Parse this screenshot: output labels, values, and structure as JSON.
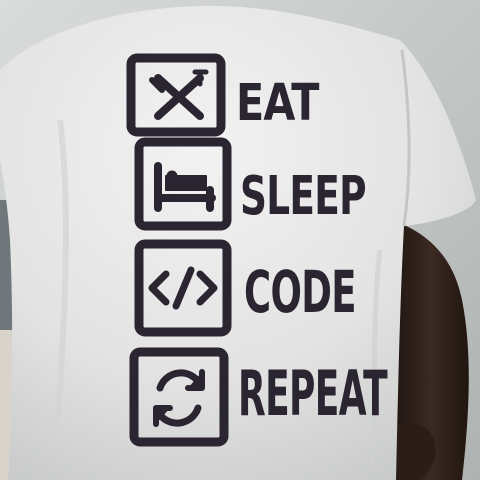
{
  "photo": {
    "subject": "t-shirt-back-print",
    "print_color": "#2a2530",
    "shirt_color": "#e3e4e3",
    "rows": [
      {
        "word": "EAT",
        "icon": "fork-knife-icon"
      },
      {
        "word": "SLEEP",
        "icon": "bed-icon"
      },
      {
        "word": "CODE",
        "icon": "code-brackets-icon"
      },
      {
        "word": "REPEAT",
        "icon": "refresh-icon"
      }
    ]
  }
}
